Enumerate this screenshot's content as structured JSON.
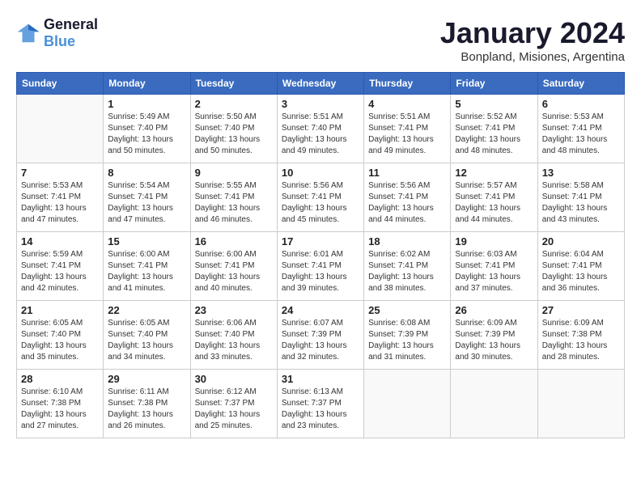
{
  "logo": {
    "line1": "General",
    "line2": "Blue"
  },
  "title": "January 2024",
  "location": "Bonpland, Misiones, Argentina",
  "days_of_week": [
    "Sunday",
    "Monday",
    "Tuesday",
    "Wednesday",
    "Thursday",
    "Friday",
    "Saturday"
  ],
  "weeks": [
    [
      {
        "day": "",
        "info": ""
      },
      {
        "day": "1",
        "info": "Sunrise: 5:49 AM\nSunset: 7:40 PM\nDaylight: 13 hours\nand 50 minutes."
      },
      {
        "day": "2",
        "info": "Sunrise: 5:50 AM\nSunset: 7:40 PM\nDaylight: 13 hours\nand 50 minutes."
      },
      {
        "day": "3",
        "info": "Sunrise: 5:51 AM\nSunset: 7:40 PM\nDaylight: 13 hours\nand 49 minutes."
      },
      {
        "day": "4",
        "info": "Sunrise: 5:51 AM\nSunset: 7:41 PM\nDaylight: 13 hours\nand 49 minutes."
      },
      {
        "day": "5",
        "info": "Sunrise: 5:52 AM\nSunset: 7:41 PM\nDaylight: 13 hours\nand 48 minutes."
      },
      {
        "day": "6",
        "info": "Sunrise: 5:53 AM\nSunset: 7:41 PM\nDaylight: 13 hours\nand 48 minutes."
      }
    ],
    [
      {
        "day": "7",
        "info": "Sunrise: 5:53 AM\nSunset: 7:41 PM\nDaylight: 13 hours\nand 47 minutes."
      },
      {
        "day": "8",
        "info": "Sunrise: 5:54 AM\nSunset: 7:41 PM\nDaylight: 13 hours\nand 47 minutes."
      },
      {
        "day": "9",
        "info": "Sunrise: 5:55 AM\nSunset: 7:41 PM\nDaylight: 13 hours\nand 46 minutes."
      },
      {
        "day": "10",
        "info": "Sunrise: 5:56 AM\nSunset: 7:41 PM\nDaylight: 13 hours\nand 45 minutes."
      },
      {
        "day": "11",
        "info": "Sunrise: 5:56 AM\nSunset: 7:41 PM\nDaylight: 13 hours\nand 44 minutes."
      },
      {
        "day": "12",
        "info": "Sunrise: 5:57 AM\nSunset: 7:41 PM\nDaylight: 13 hours\nand 44 minutes."
      },
      {
        "day": "13",
        "info": "Sunrise: 5:58 AM\nSunset: 7:41 PM\nDaylight: 13 hours\nand 43 minutes."
      }
    ],
    [
      {
        "day": "14",
        "info": "Sunrise: 5:59 AM\nSunset: 7:41 PM\nDaylight: 13 hours\nand 42 minutes."
      },
      {
        "day": "15",
        "info": "Sunrise: 6:00 AM\nSunset: 7:41 PM\nDaylight: 13 hours\nand 41 minutes."
      },
      {
        "day": "16",
        "info": "Sunrise: 6:00 AM\nSunset: 7:41 PM\nDaylight: 13 hours\nand 40 minutes."
      },
      {
        "day": "17",
        "info": "Sunrise: 6:01 AM\nSunset: 7:41 PM\nDaylight: 13 hours\nand 39 minutes."
      },
      {
        "day": "18",
        "info": "Sunrise: 6:02 AM\nSunset: 7:41 PM\nDaylight: 13 hours\nand 38 minutes."
      },
      {
        "day": "19",
        "info": "Sunrise: 6:03 AM\nSunset: 7:41 PM\nDaylight: 13 hours\nand 37 minutes."
      },
      {
        "day": "20",
        "info": "Sunrise: 6:04 AM\nSunset: 7:41 PM\nDaylight: 13 hours\nand 36 minutes."
      }
    ],
    [
      {
        "day": "21",
        "info": "Sunrise: 6:05 AM\nSunset: 7:40 PM\nDaylight: 13 hours\nand 35 minutes."
      },
      {
        "day": "22",
        "info": "Sunrise: 6:05 AM\nSunset: 7:40 PM\nDaylight: 13 hours\nand 34 minutes."
      },
      {
        "day": "23",
        "info": "Sunrise: 6:06 AM\nSunset: 7:40 PM\nDaylight: 13 hours\nand 33 minutes."
      },
      {
        "day": "24",
        "info": "Sunrise: 6:07 AM\nSunset: 7:39 PM\nDaylight: 13 hours\nand 32 minutes."
      },
      {
        "day": "25",
        "info": "Sunrise: 6:08 AM\nSunset: 7:39 PM\nDaylight: 13 hours\nand 31 minutes."
      },
      {
        "day": "26",
        "info": "Sunrise: 6:09 AM\nSunset: 7:39 PM\nDaylight: 13 hours\nand 30 minutes."
      },
      {
        "day": "27",
        "info": "Sunrise: 6:09 AM\nSunset: 7:38 PM\nDaylight: 13 hours\nand 28 minutes."
      }
    ],
    [
      {
        "day": "28",
        "info": "Sunrise: 6:10 AM\nSunset: 7:38 PM\nDaylight: 13 hours\nand 27 minutes."
      },
      {
        "day": "29",
        "info": "Sunrise: 6:11 AM\nSunset: 7:38 PM\nDaylight: 13 hours\nand 26 minutes."
      },
      {
        "day": "30",
        "info": "Sunrise: 6:12 AM\nSunset: 7:37 PM\nDaylight: 13 hours\nand 25 minutes."
      },
      {
        "day": "31",
        "info": "Sunrise: 6:13 AM\nSunset: 7:37 PM\nDaylight: 13 hours\nand 23 minutes."
      },
      {
        "day": "",
        "info": ""
      },
      {
        "day": "",
        "info": ""
      },
      {
        "day": "",
        "info": ""
      }
    ]
  ]
}
